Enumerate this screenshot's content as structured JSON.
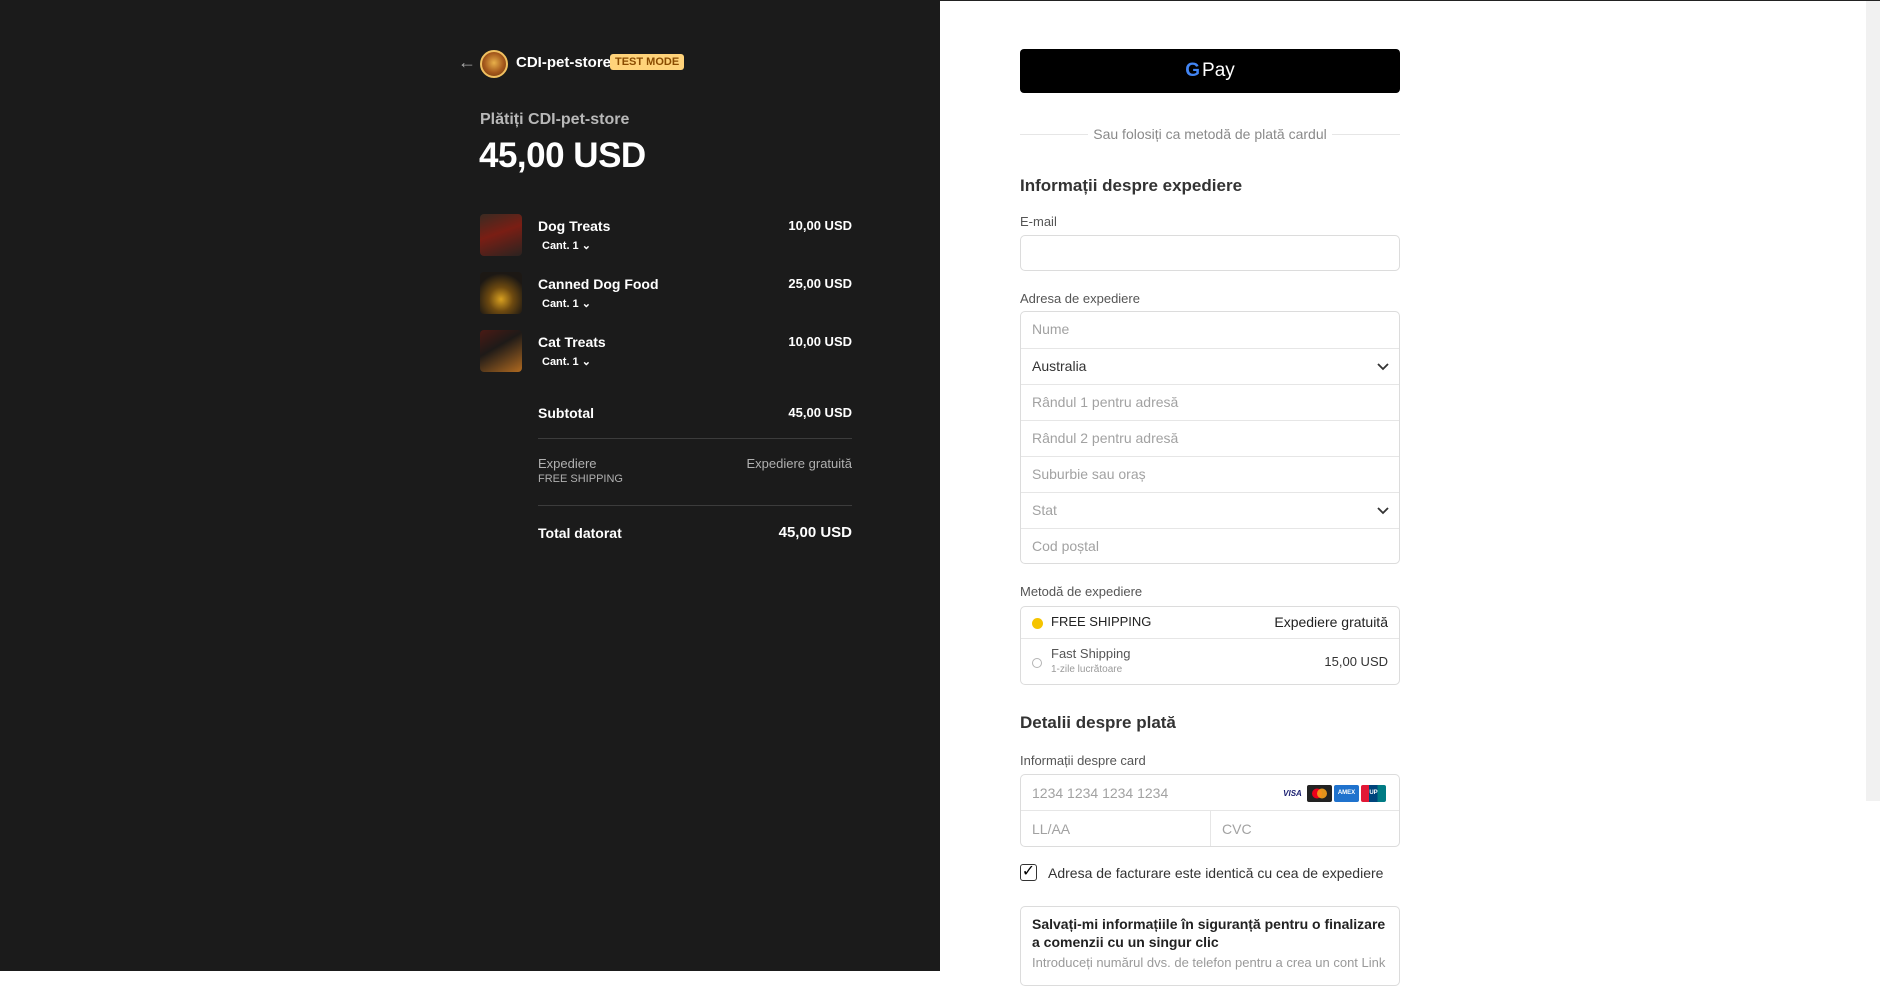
{
  "header": {
    "store_name": "CDI-pet-store",
    "test_badge": "TEST MODE",
    "pay_label": "Plătiți CDI-pet-store",
    "total_amount": "45,00 USD"
  },
  "items": [
    {
      "name": "Dog Treats",
      "qty": "Cant. 1",
      "price": "10,00 USD"
    },
    {
      "name": "Canned Dog Food",
      "qty": "Cant. 1",
      "price": "25,00 USD"
    },
    {
      "name": "Cat Treats",
      "qty": "Cant. 1",
      "price": "10,00 USD"
    }
  ],
  "summary": {
    "subtotal_label": "Subtotal",
    "subtotal_value": "45,00 USD",
    "shipping_label": "Expediere",
    "shipping_method": "FREE SHIPPING",
    "shipping_value": "Expediere gratuită",
    "total_label": "Total datorat",
    "total_value": "45,00 USD"
  },
  "payment": {
    "gpay_label": "Pay",
    "or_text": "Sau folosiți ca metodă de plată cardul",
    "shipping_info_title": "Informații despre expediere",
    "email_label": "E-mail",
    "email_value": "",
    "address_label": "Adresa de expediere",
    "name_placeholder": "Nume",
    "country_value": "Australia",
    "address1_placeholder": "Rândul 1 pentru adresă",
    "address2_placeholder": "Rândul 2 pentru adresă",
    "suburb_placeholder": "Suburbie sau oraș",
    "state_placeholder": "Stat",
    "postal_placeholder": "Cod poștal",
    "ship_method_label": "Metodă de expediere",
    "ship_options": [
      {
        "name": "FREE SHIPPING",
        "price": "Expediere gratuită",
        "note": "",
        "selected": true
      },
      {
        "name": "Fast Shipping",
        "price": "15,00 USD",
        "note": "1-zile lucrătoare",
        "selected": false
      }
    ],
    "payment_details_title": "Detalii despre plată",
    "card_info_label": "Informații despre card",
    "card_number_placeholder": "1234 1234 1234 1234",
    "card_expiry_placeholder": "LL/AA",
    "card_cvc_placeholder": "CVC",
    "card_brands": [
      "VISA",
      "mastercard",
      "amex",
      "unionpay"
    ],
    "billing_same_label": "Adresa de facturare este identică cu cea de expediere",
    "billing_same_checked": true,
    "link_title": "Salvați-mi informațiile în siguranță pentru o finalizare a comenzii cu un singur clic",
    "link_subtitle": "Introduceți numărul dvs. de telefon pentru a crea un cont Link"
  },
  "colors": {
    "left_bg": "#1b1b1b",
    "accent_yellow": "#f5c400",
    "badge_bg": "#ffd37a"
  }
}
